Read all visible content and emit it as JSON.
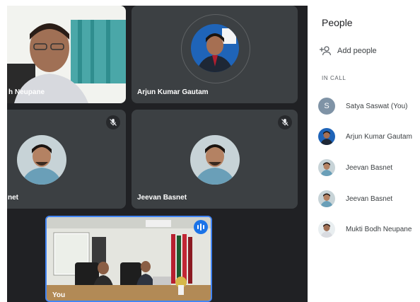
{
  "participants_grid": {
    "tile_1_name": "h Neupane",
    "tile_2_name": "Arjun Kumar Gautam",
    "tile_3_name": "net",
    "tile_4_name": "Jeevan Basnet",
    "self_tile_name": "You"
  },
  "people_panel": {
    "title": "People",
    "add_people_label": "Add people",
    "section_label": "IN CALL",
    "participants": [
      {
        "name": "Satya Saswat (You)",
        "initial": "S"
      },
      {
        "name": "Arjun Kumar Gautam"
      },
      {
        "name": "Jeevan Basnet"
      },
      {
        "name": "Jeevan Basnet"
      },
      {
        "name": "Mukti Bodh Neupane"
      }
    ]
  },
  "colors": {
    "stage_bg": "#202124",
    "tile_bg": "#3c4043",
    "speaking_accent": "#4285f4"
  }
}
